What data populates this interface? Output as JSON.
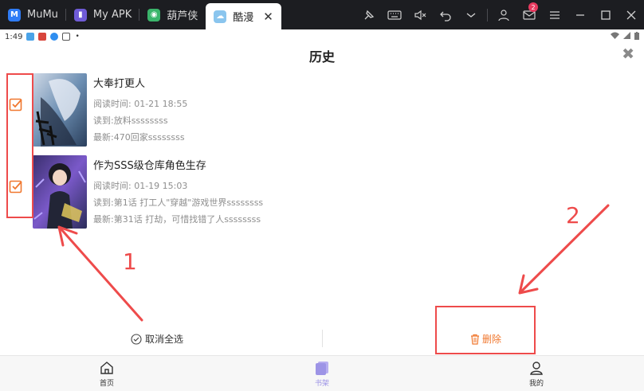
{
  "tabs": [
    {
      "label": "MuMu",
      "icon": "mumu-icon",
      "color": "#2f7cf6",
      "active": false
    },
    {
      "label": "My APK",
      "icon": "apk-icon",
      "color": "#6f5bd6",
      "active": false
    },
    {
      "label": "葫芦侠",
      "icon": "huluxia-icon",
      "color": "#3bb56b",
      "active": false
    },
    {
      "label": "酷漫",
      "icon": "comic-app-icon",
      "color": "#8ac5ee",
      "active": true
    }
  ],
  "window_controls": {
    "mail_badge": "2"
  },
  "statusbar": {
    "time": "1:49"
  },
  "header": {
    "title": "历史",
    "close_symbol": "✖"
  },
  "items": [
    {
      "name": "大奉打更人",
      "read_time": "阅读时间:  01-21 18:55",
      "read_to": "读到:放料ssssssss",
      "latest": "最新:470回家ssssssss",
      "checked": true
    },
    {
      "name": "作为SSS级仓库角色生存",
      "read_time": "阅读时间:  01-19 15:03",
      "read_to": "读到:第1话 打工人\"穿越\"游戏世界ssssssss",
      "latest": "最新:第31话 打劫，可惜找错了人ssssssss",
      "checked": true
    }
  ],
  "annotations": {
    "label_1": "1",
    "label_2": "2",
    "color": "#ee4b4b"
  },
  "actions": {
    "unselect_all": "取消全选",
    "delete": "删除",
    "delete_color": "#f0772e"
  },
  "nav": [
    {
      "label": "首页",
      "icon": "home-icon",
      "active": false
    },
    {
      "label": "书架",
      "icon": "bookshelf-icon",
      "active": true
    },
    {
      "label": "我的",
      "icon": "profile-icon",
      "active": false
    }
  ],
  "colors": {
    "accent": "#f0772e",
    "nav_active": "#9d94e6",
    "tabbar_bg": "#1c1d21"
  }
}
